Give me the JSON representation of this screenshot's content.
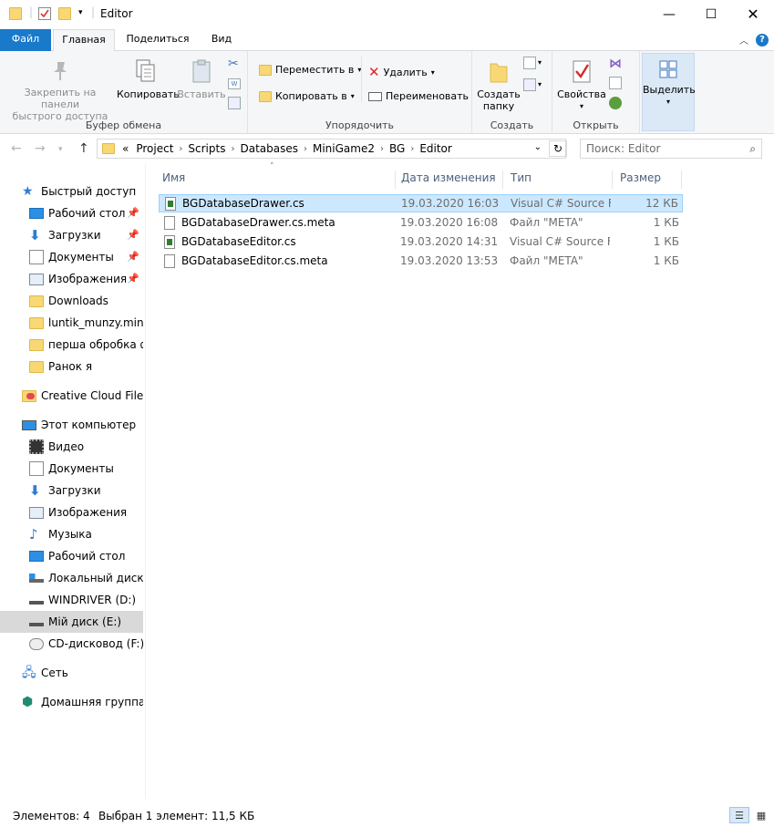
{
  "window": {
    "title": "Editor"
  },
  "ribbon_tabs": {
    "file": "Файл",
    "home": "Главная",
    "share": "Поделиться",
    "view": "Вид"
  },
  "ribbon": {
    "clipboard": {
      "label": "Буфер обмена",
      "pin": "Закрепить на панели быстрого доступа",
      "pin_l1": "Закрепить на панели",
      "pin_l2": "быстрого доступа",
      "copy": "Копировать",
      "paste": "Вставить"
    },
    "organize": {
      "label": "Упорядочить",
      "move_to": "Переместить в",
      "copy_to": "Копировать в",
      "delete": "Удалить",
      "rename": "Переименовать"
    },
    "create": {
      "label": "Создать",
      "new_folder_l1": "Создать",
      "new_folder_l2": "папку"
    },
    "open": {
      "label": "Открыть",
      "properties": "Свойства"
    },
    "select": {
      "label": "Выделить"
    }
  },
  "address": {
    "overflow": "«",
    "crumbs": [
      "Project",
      "Scripts",
      "Databases",
      "MiniGame2",
      "BG",
      "Editor"
    ]
  },
  "search": {
    "placeholder": "Поиск: Editor"
  },
  "nav": {
    "quick_access": "Быстрый доступ",
    "quick_items": [
      "Рабочий стол",
      "Загрузки",
      "Документы",
      "Изображения",
      "Downloads",
      "luntik_munzy.minig",
      "перша обробка фс",
      "Ранок я"
    ],
    "creative_cloud": "Creative Cloud Files",
    "this_pc": "Этот компьютер",
    "pc_items": [
      "Видео",
      "Документы",
      "Загрузки",
      "Изображения",
      "Музыка",
      "Рабочий стол",
      "Локальный диск (C",
      "WINDRIVER (D:)",
      "Мій диск (E:)",
      "CD-дисковод (F:)"
    ],
    "network": "Сеть",
    "homegroup": "Домашняя группа"
  },
  "columns": {
    "name": "Имя",
    "date": "Дата изменения",
    "type": "Тип",
    "size": "Размер"
  },
  "files": [
    {
      "name": "BGDatabaseDrawer.cs",
      "date": "19.03.2020 16:03",
      "type": "Visual C# Source F...",
      "size": "12 КБ"
    },
    {
      "name": "BGDatabaseDrawer.cs.meta",
      "date": "19.03.2020 16:08",
      "type": "Файл \"META\"",
      "size": "1 КБ"
    },
    {
      "name": "BGDatabaseEditor.cs",
      "date": "19.03.2020 14:31",
      "type": "Visual C# Source F...",
      "size": "1 КБ"
    },
    {
      "name": "BGDatabaseEditor.cs.meta",
      "date": "19.03.2020 13:53",
      "type": "Файл \"META\"",
      "size": "1 КБ"
    }
  ],
  "status": {
    "count": "Элементов: 4",
    "selected": "Выбран 1 элемент: 11,5 КБ"
  },
  "colors": {
    "accent": "#1979ca",
    "selection": "#cce8ff",
    "nav_selected": "#d9d9d9"
  }
}
